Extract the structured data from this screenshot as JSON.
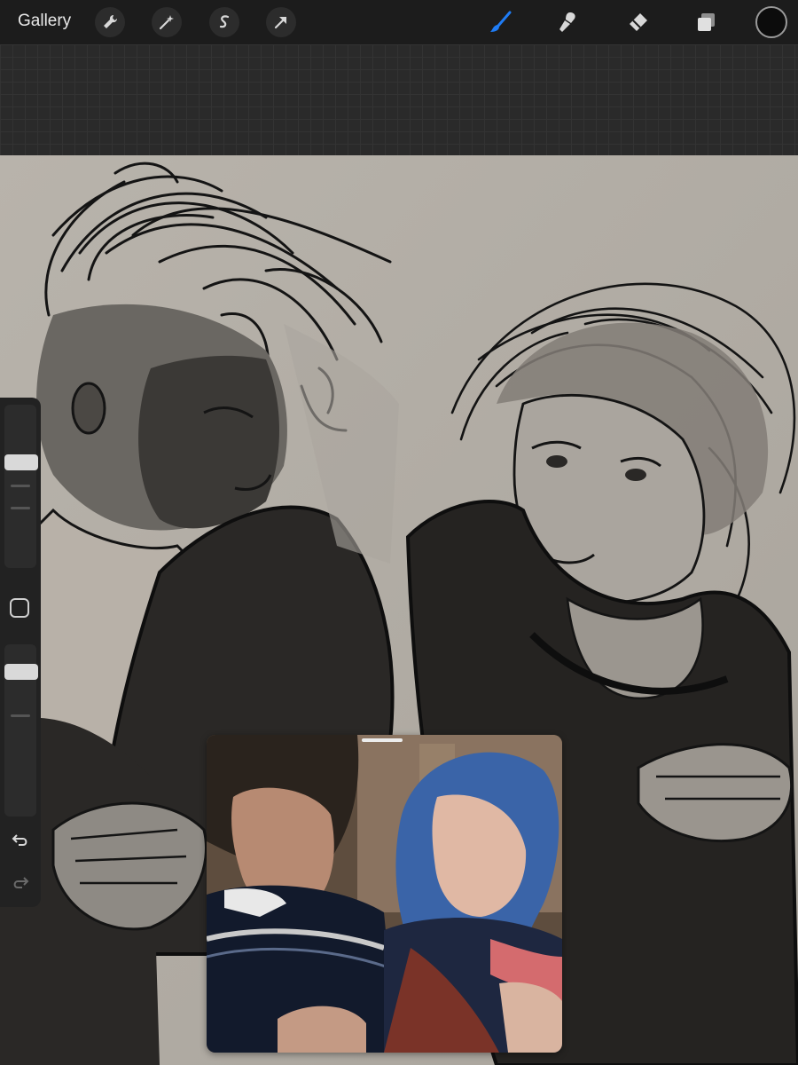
{
  "toolbar": {
    "gallery_label": "Gallery",
    "left_tools": [
      "wrench-icon",
      "magic-wand-icon",
      "selection-s-icon",
      "transform-arrow-icon"
    ],
    "right_tools": [
      "brush-icon",
      "smudge-icon",
      "eraser-icon",
      "layers-icon"
    ],
    "active_tool": "brush-icon",
    "active_color": "#0c0c0c",
    "accent_color": "#1f7cf5"
  },
  "sidebar": {
    "brush_size_level": 0.22,
    "opacity_level": 0.1,
    "icons": [
      "modify-square-icon",
      "undo-icon",
      "redo-icon"
    ]
  },
  "canvas": {
    "paper_color": "#b3aea7",
    "artwork": "two-figure-sketch"
  },
  "reference": {
    "window": "photo-reference"
  }
}
